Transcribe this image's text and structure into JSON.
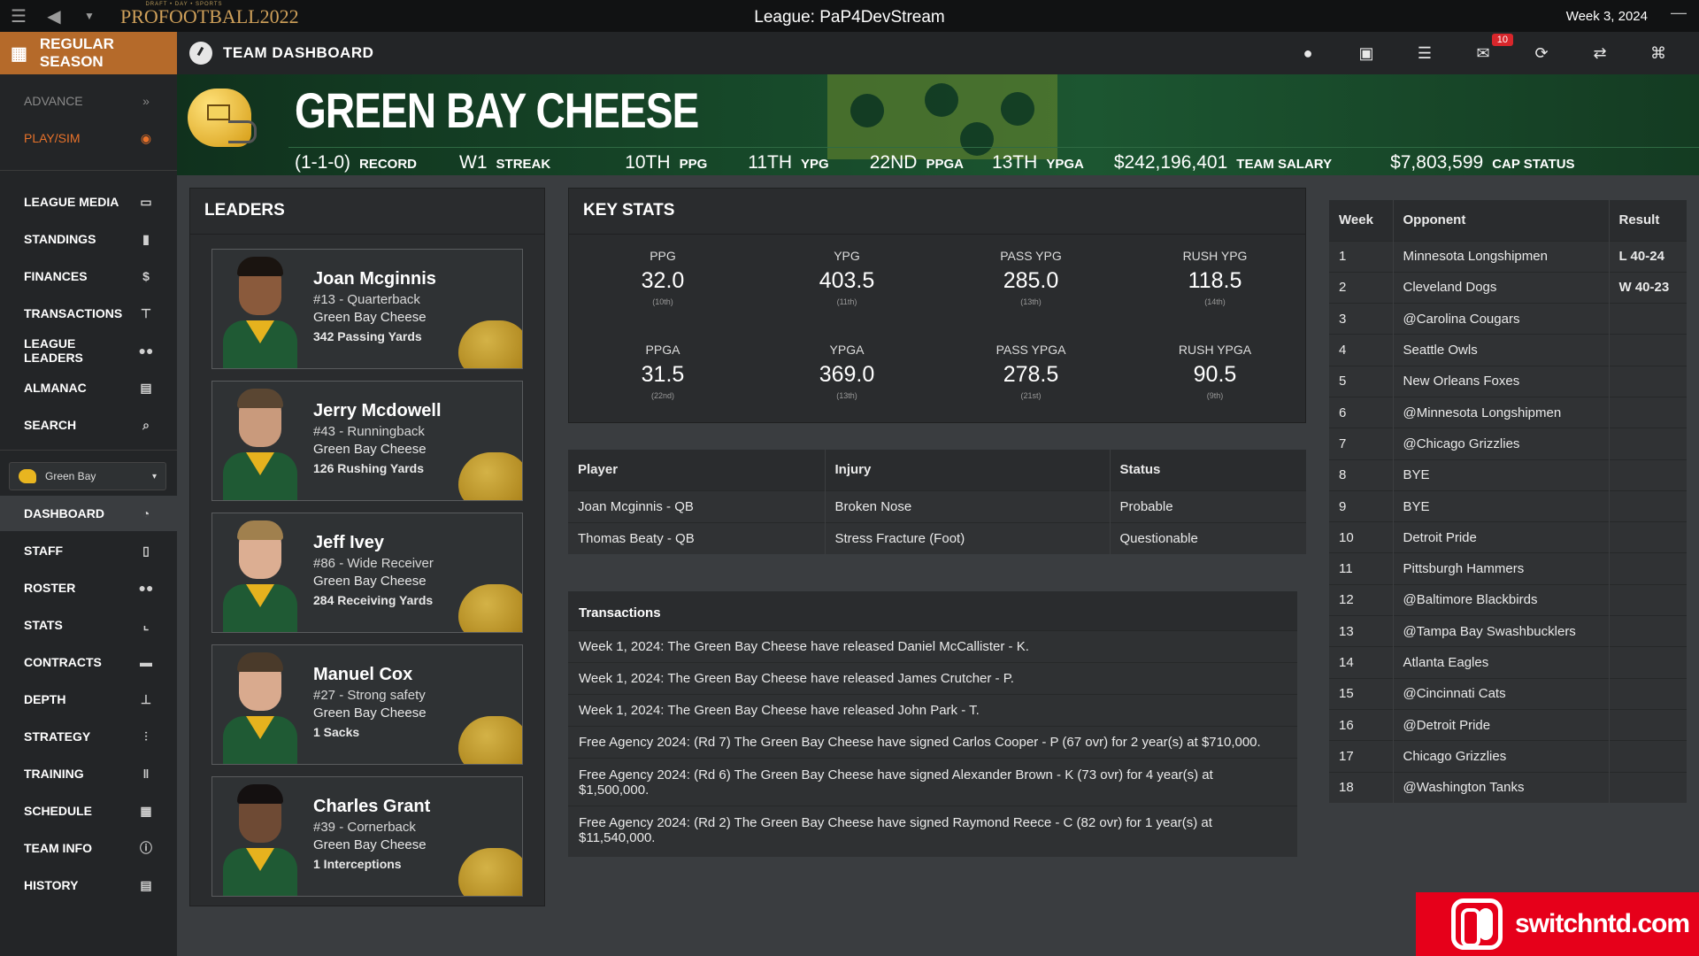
{
  "titlebar": {
    "logo_small": "DRAFT • DAY • SPORTS",
    "logo_big": "PROFOOTBALL2022",
    "league": "League: PaP4DevStream",
    "week": "Week 3, 2024"
  },
  "topnav": {
    "season": "REGULAR SEASON",
    "page_title": "TEAM DASHBOARD",
    "mail_badge": "10",
    "icons": [
      "user-icon",
      "briefcase-icon",
      "database-icon",
      "mail-icon",
      "refresh-icon",
      "handshake-icon",
      "binoculars-icon"
    ]
  },
  "sidebar": {
    "advance": "ADVANCE",
    "playsim": "PLAY/SIM",
    "items": [
      {
        "label": "LEAGUE MEDIA",
        "icon": "media-icon"
      },
      {
        "label": "STANDINGS",
        "icon": "bar-chart-icon"
      },
      {
        "label": "FINANCES",
        "icon": "dollar-icon"
      },
      {
        "label": "TRANSACTIONS",
        "icon": "signpost-icon"
      },
      {
        "label": "LEAGUE LEADERS",
        "icon": "users-icon"
      },
      {
        "label": "ALMANAC",
        "icon": "archive-icon"
      },
      {
        "label": "SEARCH",
        "icon": "search-icon"
      }
    ],
    "team_select": "Green Bay",
    "team_items": [
      {
        "label": "DASHBOARD",
        "icon": "gauge-icon"
      },
      {
        "label": "STAFF",
        "icon": "clipboard-icon"
      },
      {
        "label": "ROSTER",
        "icon": "users-icon"
      },
      {
        "label": "STATS",
        "icon": "line-chart-icon"
      },
      {
        "label": "CONTRACTS",
        "icon": "money-icon"
      },
      {
        "label": "DEPTH",
        "icon": "sitemap-icon"
      },
      {
        "label": "STRATEGY",
        "icon": "strategy-icon"
      },
      {
        "label": "TRAINING",
        "icon": "dumbbell-icon"
      },
      {
        "label": "SCHEDULE",
        "icon": "calendar-icon"
      },
      {
        "label": "TEAM INFO",
        "icon": "info-icon"
      },
      {
        "label": "HISTORY",
        "icon": "archive-icon"
      }
    ]
  },
  "banner": {
    "team_name": "GREEN BAY CHEESE",
    "stats": [
      {
        "value": "(1-1-0)",
        "label": "RECORD"
      },
      {
        "value": "W1",
        "label": "STREAK"
      },
      {
        "value": "10TH",
        "label": "PPG"
      },
      {
        "value": "11TH",
        "label": "YPG"
      },
      {
        "value": "22ND",
        "label": "PPGA"
      },
      {
        "value": "13TH",
        "label": "YPGA"
      },
      {
        "value": "$242,196,401",
        "label": "TEAM SALARY"
      },
      {
        "value": "$7,803,599",
        "label": "CAP STATUS"
      }
    ]
  },
  "leaders": {
    "title": "LEADERS",
    "players": [
      {
        "name": "Joan Mcginnis",
        "pos": "#13 - Quarterback",
        "team": "Green Bay Cheese",
        "stat": "342 Passing Yards",
        "skin": "#8a5a3c",
        "hair": "#1a1410"
      },
      {
        "name": "Jerry Mcdowell",
        "pos": "#43 - Runningback",
        "team": "Green Bay Cheese",
        "stat": "126 Rushing Yards",
        "skin": "#c99a7c",
        "hair": "#5a4632"
      },
      {
        "name": "Jeff Ivey",
        "pos": "#86 - Wide Receiver",
        "team": "Green Bay Cheese",
        "stat": "284 Receiving Yards",
        "skin": "#dcae92",
        "hair": "#a0804e"
      },
      {
        "name": "Manuel Cox",
        "pos": "#27 - Strong safety",
        "team": "Green Bay Cheese",
        "stat": "1 Sacks",
        "skin": "#d9aa8e",
        "hair": "#4a3a2a"
      },
      {
        "name": "Charles Grant",
        "pos": "#39 - Cornerback",
        "team": "Green Bay Cheese",
        "stat": "1 Interceptions",
        "skin": "#6e4a34",
        "hair": "#141010"
      }
    ]
  },
  "key_stats": {
    "title": "KEY STATS",
    "stats": [
      {
        "label": "PPG",
        "value": "32.0",
        "rank": "(10th)"
      },
      {
        "label": "YPG",
        "value": "403.5",
        "rank": "(11th)"
      },
      {
        "label": "PASS YPG",
        "value": "285.0",
        "rank": "(13th)"
      },
      {
        "label": "RUSH YPG",
        "value": "118.5",
        "rank": "(14th)"
      },
      {
        "label": "PPGA",
        "value": "31.5",
        "rank": "(22nd)"
      },
      {
        "label": "YPGA",
        "value": "369.0",
        "rank": "(13th)"
      },
      {
        "label": "PASS YPGA",
        "value": "278.5",
        "rank": "(21st)"
      },
      {
        "label": "RUSH YPGA",
        "value": "90.5",
        "rank": "(9th)"
      }
    ]
  },
  "injuries": {
    "headers": [
      "Player",
      "Injury",
      "Status"
    ],
    "rows": [
      [
        "Joan Mcginnis - QB",
        "Broken Nose",
        "Probable"
      ],
      [
        "Thomas Beaty - QB",
        "Stress Fracture (Foot)",
        "Questionable"
      ]
    ]
  },
  "transactions": {
    "title": "Transactions",
    "rows": [
      "Week 1, 2024: The Green Bay Cheese have released Daniel McCallister - K.",
      "Week 1, 2024: The Green Bay Cheese have released James Crutcher - P.",
      "Week 1, 2024: The Green Bay Cheese have released John Park - T.",
      "Free Agency 2024: (Rd 7) The Green Bay Cheese have signed Carlos Cooper - P (67 ovr) for 2 year(s) at $710,000.",
      "Free Agency 2024: (Rd 6) The Green Bay Cheese have signed Alexander Brown - K (73 ovr) for 4 year(s) at $1,500,000.",
      "Free Agency 2024: (Rd 2) The Green Bay Cheese have signed Raymond Reece - C (82 ovr) for 1 year(s) at $11,540,000."
    ]
  },
  "schedule": {
    "headers": [
      "Week",
      "Opponent",
      "Result"
    ],
    "rows": [
      [
        "1",
        "Minnesota Longshipmen",
        "L 40-24"
      ],
      [
        "2",
        "Cleveland Dogs",
        "W 40-23"
      ],
      [
        "3",
        "@Carolina Cougars",
        ""
      ],
      [
        "4",
        "Seattle Owls",
        ""
      ],
      [
        "5",
        "New Orleans Foxes",
        ""
      ],
      [
        "6",
        "@Minnesota Longshipmen",
        ""
      ],
      [
        "7",
        "@Chicago Grizzlies",
        ""
      ],
      [
        "8",
        "BYE",
        ""
      ],
      [
        "9",
        "BYE",
        ""
      ],
      [
        "10",
        "Detroit Pride",
        ""
      ],
      [
        "11",
        "Pittsburgh Hammers",
        ""
      ],
      [
        "12",
        "@Baltimore Blackbirds",
        ""
      ],
      [
        "13",
        "@Tampa Bay Swashbucklers",
        ""
      ],
      [
        "14",
        "Atlanta Eagles",
        ""
      ],
      [
        "15",
        "@Cincinnati Cats",
        ""
      ],
      [
        "16",
        "@Detroit Pride",
        ""
      ],
      [
        "17",
        "Chicago Grizzlies",
        ""
      ],
      [
        "18",
        "@Washington Tanks",
        ""
      ]
    ]
  },
  "watermark": {
    "text": "switchntd.com"
  }
}
